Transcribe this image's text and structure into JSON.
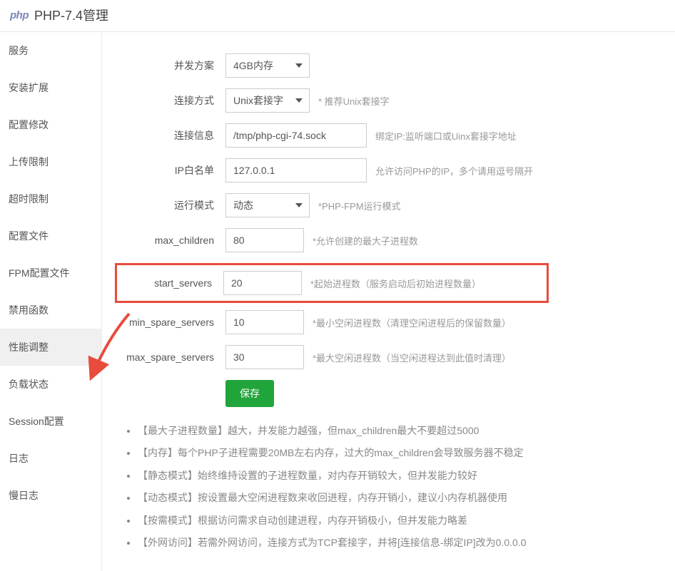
{
  "header": {
    "logo": "php",
    "title": "PHP-7.4管理"
  },
  "sidebar": {
    "items": [
      {
        "label": "服务"
      },
      {
        "label": "安装扩展"
      },
      {
        "label": "配置修改"
      },
      {
        "label": "上传限制"
      },
      {
        "label": "超时限制"
      },
      {
        "label": "配置文件"
      },
      {
        "label": "FPM配置文件"
      },
      {
        "label": "禁用函数"
      },
      {
        "label": "性能调整"
      },
      {
        "label": "负载状态"
      },
      {
        "label": "Session配置"
      },
      {
        "label": "日志"
      },
      {
        "label": "慢日志"
      }
    ]
  },
  "form": {
    "concurrency": {
      "label": "并发方案",
      "value": "4GB内存"
    },
    "conn_type": {
      "label": "连接方式",
      "value": "Unix套接字",
      "hint": "* 推荐Unix套接字"
    },
    "conn_info": {
      "label": "连接信息",
      "value": "/tmp/php-cgi-74.sock",
      "hint": "绑定IP:监听端口或Uinx套接字地址"
    },
    "ip_whitelist": {
      "label": "IP白名单",
      "value": "127.0.0.1",
      "hint": "允许访问PHP的IP，多个请用逗号隔开"
    },
    "run_mode": {
      "label": "运行模式",
      "value": "动态",
      "hint": "*PHP-FPM运行模式"
    },
    "max_children": {
      "label": "max_children",
      "value": "80",
      "hint": "*允许创建的最大子进程数"
    },
    "start_servers": {
      "label": "start_servers",
      "value": "20",
      "hint": "*起始进程数（服务启动后初始进程数量）"
    },
    "min_spare": {
      "label": "min_spare_servers",
      "value": "10",
      "hint": "*最小空闲进程数（清理空闲进程后的保留数量）"
    },
    "max_spare": {
      "label": "max_spare_servers",
      "value": "30",
      "hint": "*最大空闲进程数（当空闲进程达到此值时清理）"
    },
    "save": "保存"
  },
  "notes": [
    "【最大子进程数量】越大，并发能力越强，但max_children最大不要超过5000",
    "【内存】每个PHP子进程需要20MB左右内存，过大的max_children会导致服务器不稳定",
    "【静态模式】始终维持设置的子进程数量，对内存开销较大，但并发能力较好",
    "【动态模式】按设置最大空闲进程数来收回进程，内存开销小，建议小内存机器使用",
    "【按需模式】根据访问需求自动创建进程，内存开销极小，但并发能力略差",
    "【外网访问】若需外网访问，连接方式为TCP套接字，并将[连接信息-绑定IP]改为0.0.0.0"
  ]
}
